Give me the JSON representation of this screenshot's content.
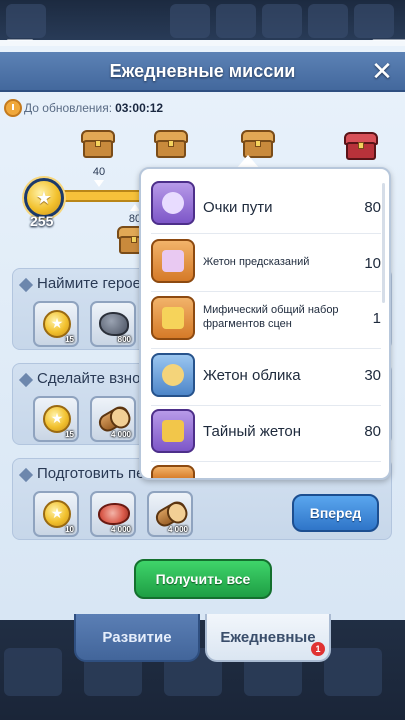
{
  "header": {
    "title": "Ежедневные миссии"
  },
  "timer": {
    "label": "До обновления:",
    "value": "03:00:12"
  },
  "progress": {
    "points": "255",
    "milestones": [
      {
        "value": "40"
      },
      {
        "value": "80"
      }
    ]
  },
  "missions": [
    {
      "title": "Наймите героев",
      "rewards": [
        {
          "icon": "coin-icon",
          "qty": "15"
        },
        {
          "icon": "ore-icon",
          "qty": "800"
        }
      ]
    },
    {
      "title": "Сделайте взнос",
      "rewards": [
        {
          "icon": "coin-icon",
          "qty": "15"
        },
        {
          "icon": "wood-icon",
          "qty": "4 000"
        }
      ]
    },
    {
      "title": "Подготовить пе",
      "rewards": [
        {
          "icon": "coin-icon",
          "qty": "10"
        },
        {
          "icon": "meat-icon",
          "qty": "4 000"
        },
        {
          "icon": "wood-icon",
          "qty": "4 000"
        }
      ]
    }
  ],
  "popup": {
    "items": [
      {
        "name": "Очки пути",
        "count": "80",
        "color": "purple"
      },
      {
        "name": "Жетон предсказаний",
        "count": "10",
        "color": "orange"
      },
      {
        "name": "Мифический общий набор фрагментов сцен",
        "count": "1",
        "color": "orange"
      },
      {
        "name": "Жетон облика",
        "count": "30",
        "color": "blue"
      },
      {
        "name": "Тайный жетон",
        "count": "80",
        "color": "purple"
      }
    ]
  },
  "buttons": {
    "forward": "Вперед",
    "claim_all": "Получить все"
  },
  "tabs": {
    "development": "Развитие",
    "daily": "Ежедневные",
    "daily_badge": "1"
  },
  "colors": {
    "header": "#4f75aa",
    "claim": "#2cb855",
    "forward": "#3f8ce0",
    "badge": "#e03232"
  }
}
